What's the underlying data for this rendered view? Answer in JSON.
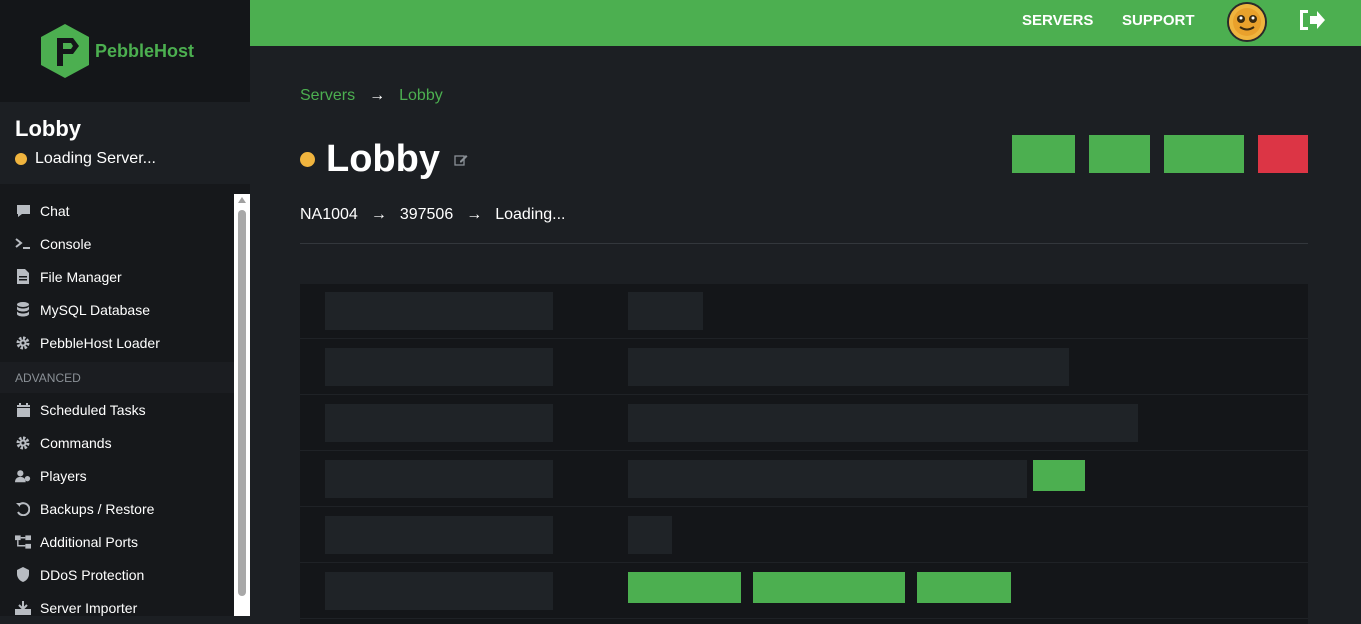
{
  "brand": {
    "name": "PebbleHost"
  },
  "server": {
    "name": "Lobby",
    "status": "Loading Server..."
  },
  "nav": {
    "items": [
      {
        "label": "Chat",
        "icon": "chat-icon"
      },
      {
        "label": "Console",
        "icon": "terminal-icon"
      },
      {
        "label": "File Manager",
        "icon": "file-icon"
      },
      {
        "label": "MySQL Database",
        "icon": "database-icon"
      },
      {
        "label": "PebbleHost Loader",
        "icon": "gear-icon"
      }
    ],
    "advanced_label": "ADVANCED",
    "advanced_items": [
      {
        "label": "Scheduled Tasks",
        "icon": "calendar-icon"
      },
      {
        "label": "Commands",
        "icon": "gear-icon"
      },
      {
        "label": "Players",
        "icon": "users-icon"
      },
      {
        "label": "Backups / Restore",
        "icon": "history-icon"
      },
      {
        "label": "Additional Ports",
        "icon": "network-icon"
      },
      {
        "label": "DDoS Protection",
        "icon": "shield-icon"
      },
      {
        "label": "Server Importer",
        "icon": "import-icon"
      }
    ]
  },
  "topbar": {
    "servers": "SERVERS",
    "support": "SUPPORT"
  },
  "breadcrumb": {
    "root": "Servers",
    "arrow": "→",
    "current": "Lobby"
  },
  "page": {
    "title": "Lobby"
  },
  "path": {
    "node": "NA1004",
    "arrow": "→",
    "id": "397506",
    "status": "Loading..."
  },
  "colors": {
    "accent": "#4caf50",
    "danger": "#dc3545",
    "status_loading": "#f0b43e",
    "background": "#1c1f23"
  }
}
